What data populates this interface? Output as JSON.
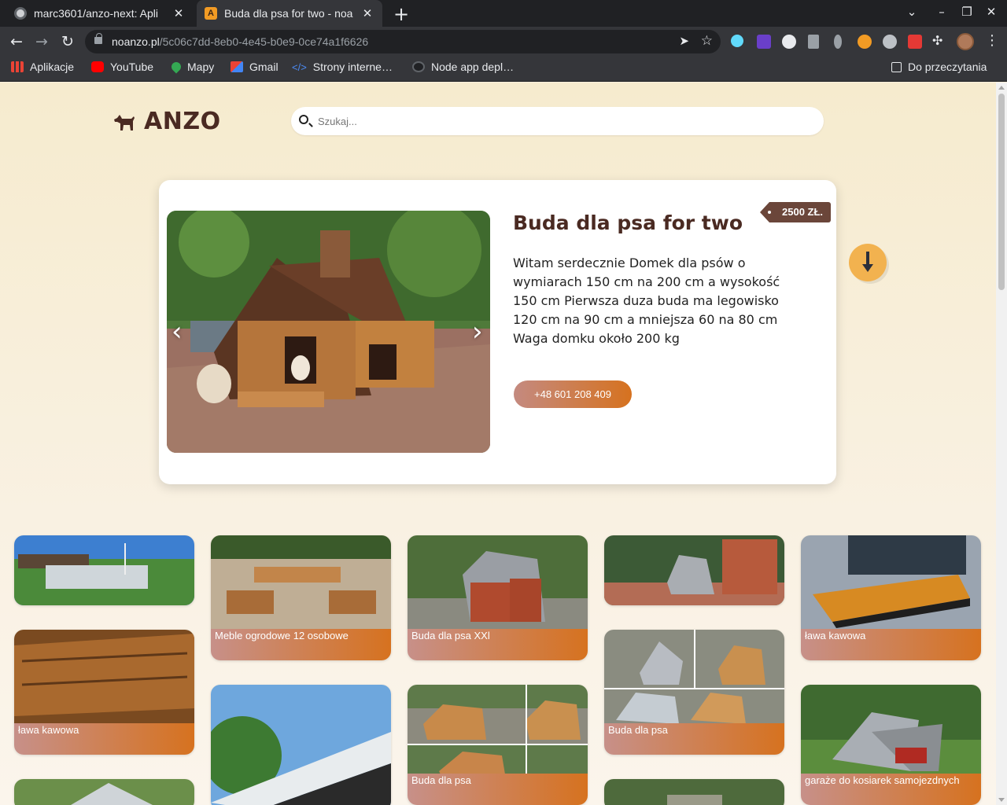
{
  "browser": {
    "tabs": [
      {
        "title": "marc3601/anzo-next: Apli",
        "active": false
      },
      {
        "title": "Buda dla psa for two - noa",
        "active": true
      }
    ],
    "url_host": "noanzo.pl",
    "url_path": "/5c06c7dd-8eb0-4e45-b0e9-0ce74a1f6626",
    "bookmarks": [
      "Aplikacje",
      "YouTube",
      "Mapy",
      "Gmail",
      "Strony interne…",
      "Node app depl…"
    ],
    "reading_list": "Do przeczytania"
  },
  "site": {
    "logo": "ANZO",
    "search_placeholder": "Szukaj..."
  },
  "product": {
    "title": "Buda dla psa for two",
    "price": "2500 ZŁ.",
    "description": "Witam serdecznie Domek dla psów o wymiarach 150 cm na 200 cm a wysokość 150 cm Pierwsza duza buda ma legowisko 120 cm na 90 cm a mniejsza 60 na 80 cm Waga domku około 200 kg",
    "phone": "+48 601 208 409",
    "prev_arrow": "‹",
    "next_arrow": "›"
  },
  "tiles": [
    {
      "caption": ""
    },
    {
      "caption": "Meble ogrodowe 12 osobowe"
    },
    {
      "caption": "Buda dla psa XXl"
    },
    {
      "caption": ""
    },
    {
      "caption": "ława kawowa"
    },
    {
      "caption": "ława kawowa"
    },
    {
      "caption": ""
    },
    {
      "caption": "Buda dla psa"
    },
    {
      "caption": "Buda dla psa"
    },
    {
      "caption": "garaże do kosiarek samojezdnych"
    },
    {
      "caption": ""
    },
    {
      "caption": ""
    }
  ],
  "colors": {
    "brand_brown": "#4a2a22",
    "accent_orange": "#d6721f",
    "price_tag": "#6b463a",
    "down_button": "#f2b24f"
  }
}
